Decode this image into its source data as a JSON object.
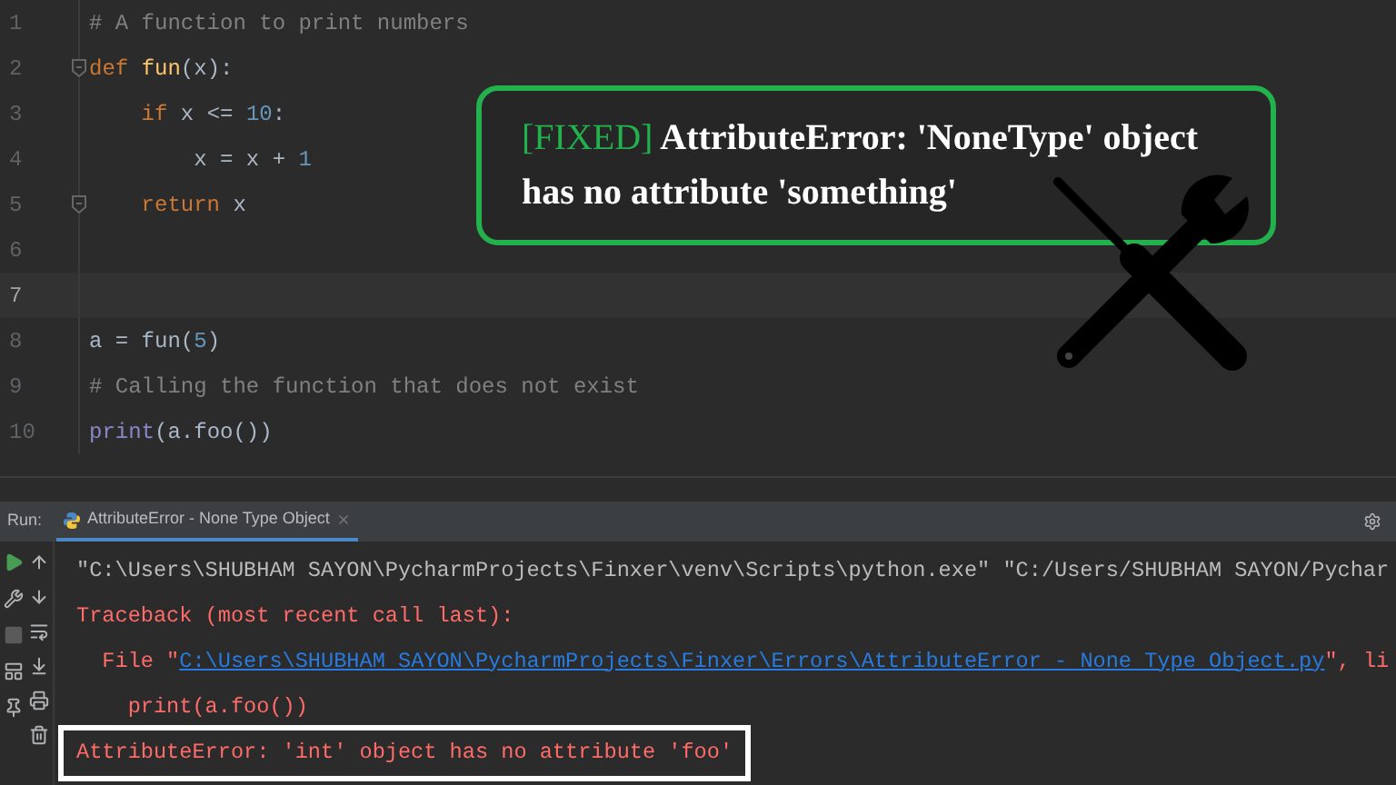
{
  "editor": {
    "lines": [
      {
        "number": "1",
        "current": false,
        "fold": false,
        "tokens": [
          {
            "kind": "comment",
            "text": "# A function to print numbers"
          }
        ]
      },
      {
        "number": "2",
        "current": false,
        "fold": true,
        "tokens": [
          {
            "kind": "keyword",
            "text": "def "
          },
          {
            "kind": "function",
            "text": "fun"
          },
          {
            "kind": "plain",
            "text": "(x):"
          }
        ]
      },
      {
        "number": "3",
        "current": false,
        "fold": false,
        "tokens": [
          {
            "kind": "keyword",
            "text": "    if "
          },
          {
            "kind": "plain",
            "text": "x <= "
          },
          {
            "kind": "number",
            "text": "10"
          },
          {
            "kind": "plain",
            "text": ":"
          }
        ]
      },
      {
        "number": "4",
        "current": false,
        "fold": false,
        "tokens": [
          {
            "kind": "plain",
            "text": "        x = x + "
          },
          {
            "kind": "number",
            "text": "1"
          }
        ]
      },
      {
        "number": "5",
        "current": false,
        "fold": true,
        "tokens": [
          {
            "kind": "keyword",
            "text": "    return "
          },
          {
            "kind": "plain",
            "text": "x"
          }
        ]
      },
      {
        "number": "6",
        "current": false,
        "fold": false
      },
      {
        "number": "7",
        "current": true,
        "fold": false
      },
      {
        "number": "8",
        "current": false,
        "fold": false,
        "tokens": [
          {
            "kind": "plain",
            "text": "a = fun("
          },
          {
            "kind": "number",
            "text": "5"
          },
          {
            "kind": "plain",
            "text": ")"
          }
        ]
      },
      {
        "number": "9",
        "current": false,
        "fold": false,
        "tokens": [
          {
            "kind": "comment",
            "text": "# Calling the function that does not exist"
          }
        ]
      },
      {
        "number": "10",
        "current": false,
        "fold": false,
        "tokens": [
          {
            "kind": "builtin",
            "text": "print"
          },
          {
            "kind": "plain",
            "text": "(a.foo())"
          }
        ]
      }
    ]
  },
  "banner": {
    "tag": "[FIXED]",
    "title": "AttributeError: 'NoneType' object has no attribute 'something'"
  },
  "run_panel": {
    "label": "Run:",
    "tab": {
      "title": "AttributeError - None Type Object",
      "selected": true
    },
    "console": [
      {
        "boxed": false,
        "segments": [
          {
            "kind": "plain",
            "text": "\"C:\\Users\\SHUBHAM SAYON\\PycharmProjects\\Finxer\\venv\\Scripts\\python.exe\" \"C:/Users/SHUBHAM SAYON/Pychar"
          }
        ]
      },
      {
        "boxed": false,
        "segments": [
          {
            "kind": "error",
            "text": "Traceback (most recent call last):"
          }
        ]
      },
      {
        "boxed": false,
        "segments": [
          {
            "kind": "error",
            "text": "  File \""
          },
          {
            "kind": "link",
            "text": "C:\\Users\\SHUBHAM SAYON\\PycharmProjects\\Finxer\\Errors\\AttributeError - None Type Object.py"
          },
          {
            "kind": "error",
            "text": "\", li"
          }
        ]
      },
      {
        "boxed": false,
        "segments": [
          {
            "kind": "error",
            "text": "    print(a.foo())"
          }
        ]
      },
      {
        "boxed": true,
        "segments": [
          {
            "kind": "error",
            "text": "AttributeError: 'int' object has no attribute 'foo'"
          }
        ]
      }
    ]
  }
}
